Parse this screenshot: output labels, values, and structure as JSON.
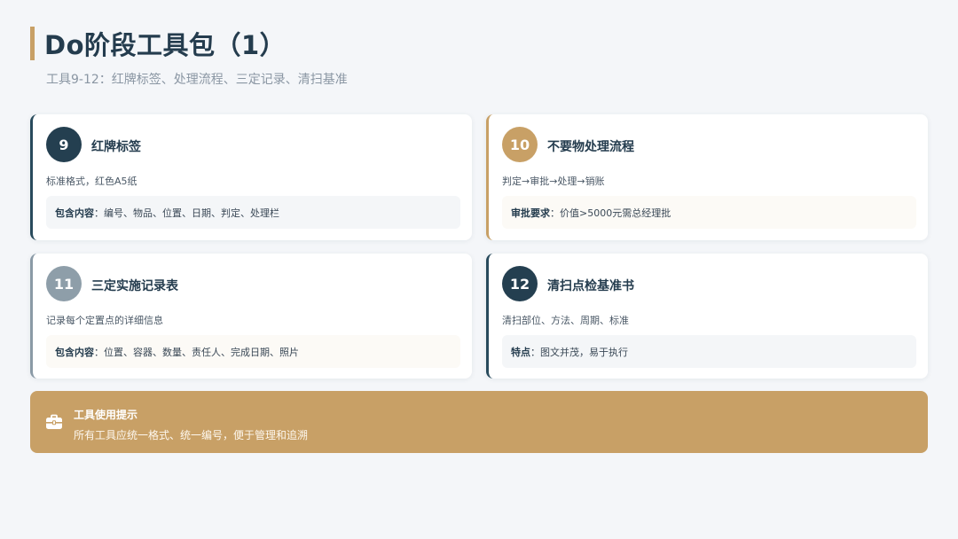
{
  "header": {
    "title": "Do阶段工具包（1）",
    "subtitle": "工具9-12：红牌标签、处理流程、三定记录、清扫基准"
  },
  "cards": [
    {
      "number": "9",
      "title": "红牌标签",
      "description": "标准格式，红色A5纸",
      "note_label": "包含内容",
      "note_text": "：编号、物品、位置、日期、判定、处理栏"
    },
    {
      "number": "10",
      "title": "不要物处理流程",
      "description": "判定→审批→处理→销账",
      "note_label": "审批要求",
      "note_text": "：价值>5000元需总经理批"
    },
    {
      "number": "11",
      "title": "三定实施记录表",
      "description": "记录每个定置点的详细信息",
      "note_label": "包含内容",
      "note_text": "：位置、容器、数量、责任人、完成日期、照片"
    },
    {
      "number": "12",
      "title": "清扫点检基准书",
      "description": "清扫部位、方法、周期、标准",
      "note_label": "特点",
      "note_text": "：图文并茂，易于执行"
    }
  ],
  "tip": {
    "icon": "toolbox-icon",
    "title": "工具使用提示",
    "text": "所有工具应统一格式、统一编号，便于管理和追溯"
  },
  "colors": {
    "navy": "#243f50",
    "gold": "#c8a066",
    "grey": "#8e9ea9",
    "background": "#f4f6f9"
  }
}
